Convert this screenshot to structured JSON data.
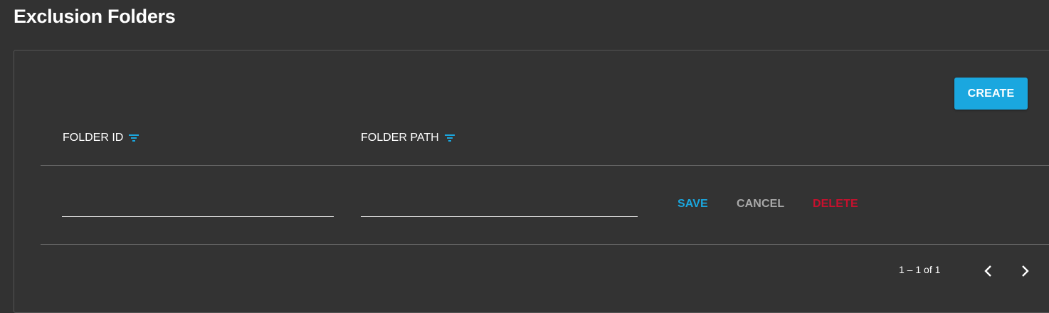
{
  "page": {
    "title": "Exclusion Folders"
  },
  "toolbar": {
    "create_label": "CREATE"
  },
  "table": {
    "columns": [
      {
        "label": "FOLDER ID",
        "filter_icon": "filter-list-icon"
      },
      {
        "label": "FOLDER PATH",
        "filter_icon": "filter-list-icon"
      }
    ],
    "edit_row": {
      "folder_id_value": "",
      "folder_path_value": "",
      "actions": {
        "save": "SAVE",
        "cancel": "CANCEL",
        "delete": "DELETE"
      }
    }
  },
  "pagination": {
    "range_text": "1 – 1 of 1",
    "prev_icon": "chevron-left-icon",
    "next_icon": "chevron-right-icon"
  },
  "colors": {
    "background": "#323232",
    "accent": "#1aa7df",
    "cancel": "#a9a9a9",
    "danger": "#c8102e"
  }
}
